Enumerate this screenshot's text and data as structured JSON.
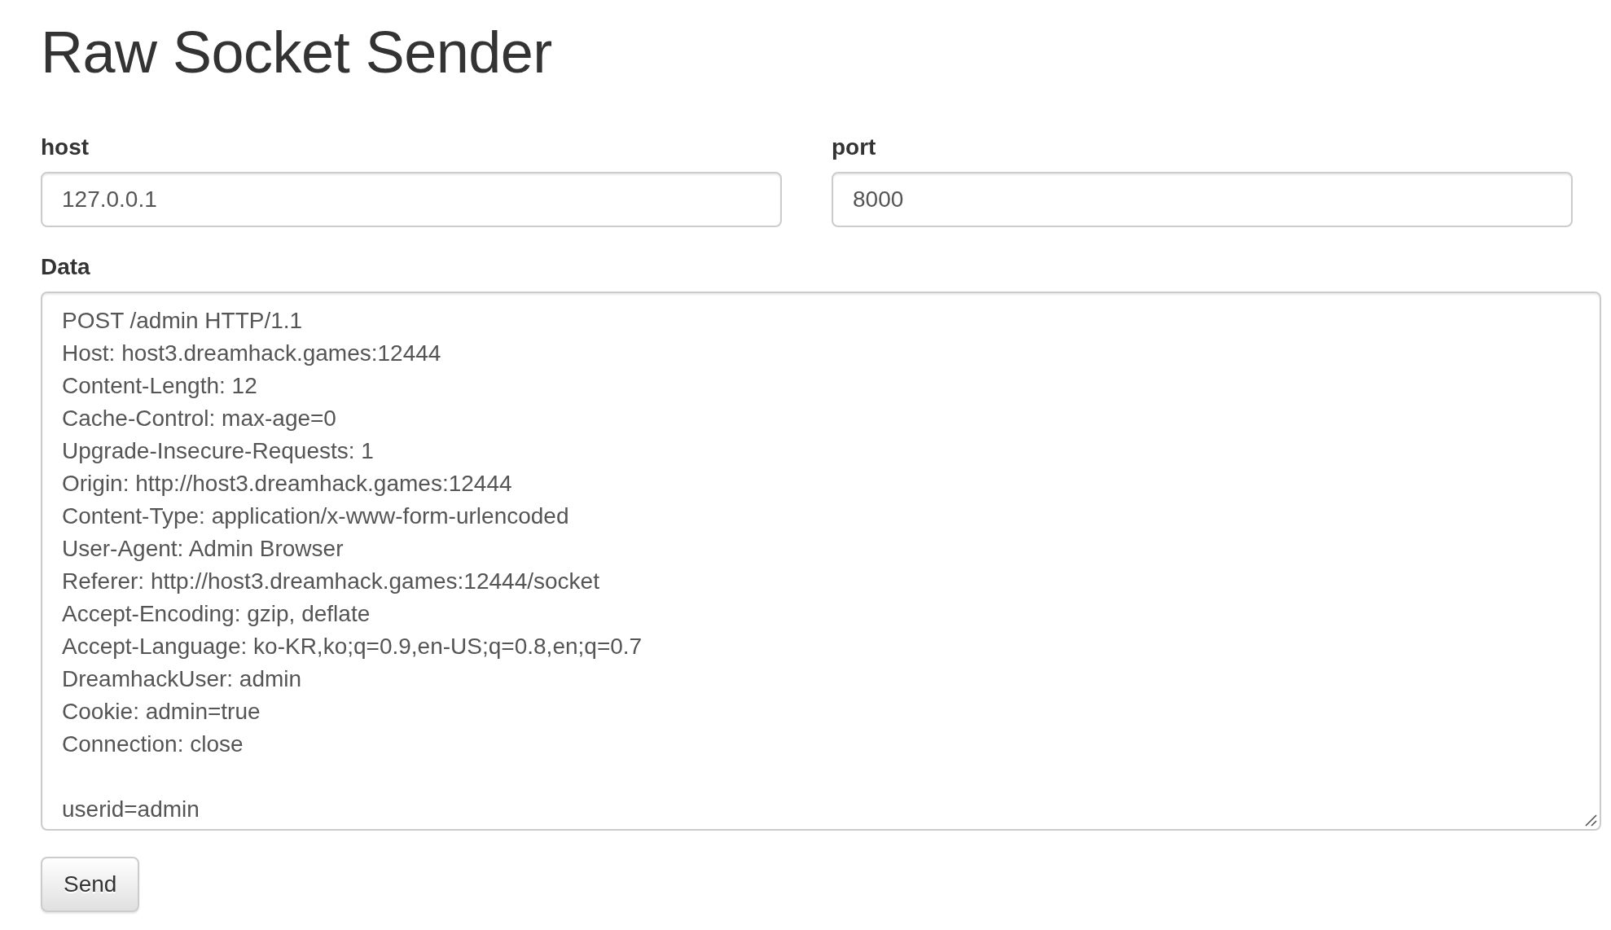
{
  "title": "Raw Socket Sender",
  "fields": [
    {
      "label": "host",
      "value": "127.0.0.1"
    },
    {
      "label": "port",
      "value": "8000"
    }
  ],
  "data": {
    "label": "Data",
    "headers": [
      "POST /admin HTTP/1.1",
      "Host: host3.dreamhack.games:12444",
      "Content-Length: 12",
      "Cache-Control: max-age=0",
      "Upgrade-Insecure-Requests: 1",
      "Origin: http://host3.dreamhack.games:12444",
      "Content-Type: application/x-www-form-urlencoded",
      "User-Agent: Admin Browser",
      "Referer: http://host3.dreamhack.games:12444/socket",
      "Accept-Encoding: gzip, deflate",
      "Accept-Language: ko-KR,ko;q=0.9,en-US;q=0.8,en;q=0.7",
      "DreamhackUser: admin",
      "Cookie: admin=true",
      "Connection: close"
    ],
    "body": "userid=admin"
  },
  "send_button": {
    "label": "Send"
  }
}
